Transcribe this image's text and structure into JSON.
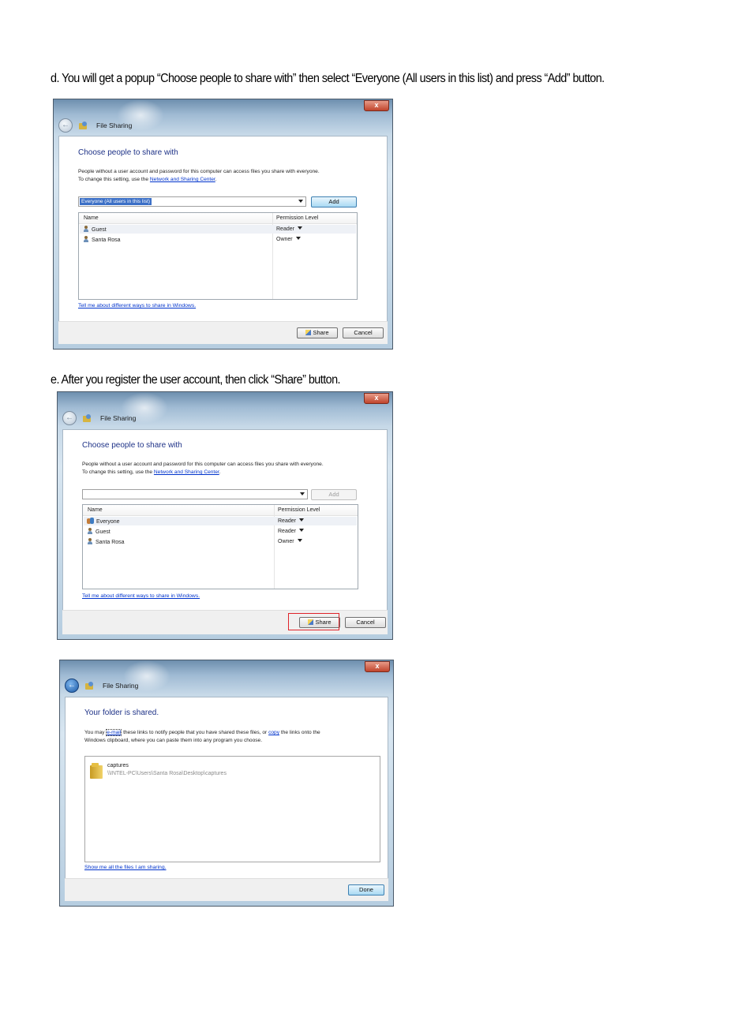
{
  "step_d": {
    "caption": "d. You will get a popup “Choose people to share with” then select “Everyone (All users in this list) and press “Add” button.",
    "dialog": {
      "close_label": "x",
      "window_title": "File Sharing",
      "heading": "Choose people to share with",
      "para_line1": "People without a user account and password for this computer can access files you share with everyone.",
      "para_line2_prefix": "To change this setting, use the",
      "para_link": "Network and Sharing Center",
      "para_suffix": ".",
      "combo_value": "Everyone (All users in this list)",
      "add_label": "Add",
      "col_name": "Name",
      "col_permission": "Permission Level",
      "rows": [
        {
          "name": "Guest",
          "permission": "Reader"
        },
        {
          "name": "Santa Rosa",
          "permission": "Owner"
        }
      ],
      "help_link": "Tell me about different ways to share in Windows.",
      "share_label": "Share",
      "cancel_label": "Cancel"
    }
  },
  "step_e": {
    "caption": "e. After you register the user account, then click “Share” button.",
    "dialog": {
      "close_label": "x",
      "window_title": "File Sharing",
      "heading": "Choose people to share with",
      "para_line1": "People without a user account and password for this computer can access files you share with everyone.",
      "para_line2_prefix": "To change this setting, use the",
      "para_link": "Network and Sharing Center",
      "para_suffix": ".",
      "add_label": "Add",
      "col_name": "Name",
      "col_permission": "Permission Level",
      "rows": [
        {
          "name": "Everyone",
          "permission": "Reader"
        },
        {
          "name": "Guest",
          "permission": "Reader"
        },
        {
          "name": "Santa Rosa",
          "permission": "Owner"
        }
      ],
      "help_link": "Tell me about different ways to share in Windows.",
      "share_label": "Share",
      "cancel_label": "Cancel"
    }
  },
  "step_done": {
    "dialog": {
      "close_label": "x",
      "window_title": "File Sharing",
      "heading": "Your folder is shared.",
      "para_line1_prefix": "You may",
      "email_link": "e-mail",
      "para_line1_middle": "these links to notify people that you have shared these files, or",
      "copy_link": "copy",
      "para_line1_suffix": "the links onto the",
      "para_line2": "Windows clipboard, where you can paste them into any program you choose.",
      "folder_name": "captures",
      "folder_path": "\\\\INTEL-PC\\Users\\Santa Rosa\\Desktop\\captures",
      "show_link": "Show me all the files I am sharing.",
      "done_label": "Done"
    }
  }
}
